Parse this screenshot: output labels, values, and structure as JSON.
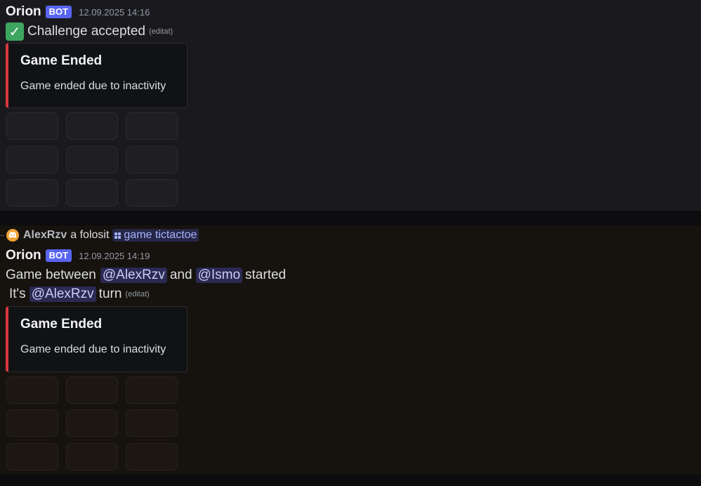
{
  "message1": {
    "author": "Orion",
    "bot_tag": "BOT",
    "timestamp": "12.09.2025 14:16",
    "check_icon": "✓",
    "content": "Challenge accepted",
    "edited_label": "(editat)",
    "embed": {
      "title": "Game Ended",
      "description": "Game ended due to inactivity",
      "accent_color": "#da373c"
    }
  },
  "message2": {
    "reply": {
      "user": "AlexRzv",
      "action": "a folosit",
      "command": "game tictactoe"
    },
    "author": "Orion",
    "bot_tag": "BOT",
    "timestamp": "12.09.2025 14:19",
    "line1": {
      "prefix": "Game between",
      "mention1": "@AlexRzv",
      "and": "and",
      "mention2": "@Ismo",
      "suffix": "started"
    },
    "line2": {
      "prefix": "It's",
      "mention": "@AlexRzv",
      "suffix": "turn"
    },
    "edited_label": "(editat)",
    "embed": {
      "title": "Game Ended",
      "description": "Game ended due to inactivity",
      "accent_color": "#da373c"
    }
  },
  "colors": {
    "bot_tag": "#5865f2",
    "mention_bg": "rgba(88,101,242,0.3)",
    "embed_accent": "#da373c"
  }
}
